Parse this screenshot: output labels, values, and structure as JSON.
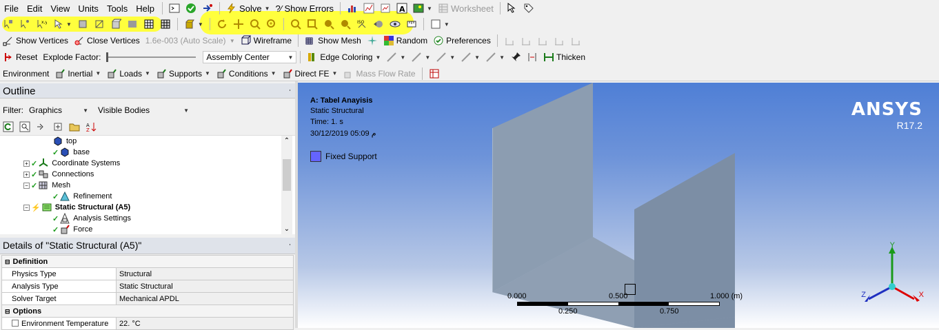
{
  "menubar": {
    "items": [
      "File",
      "Edit",
      "View",
      "Units",
      "Tools",
      "Help"
    ],
    "solve_label": "Solve",
    "show_errors_label": "?⁄ Show Errors",
    "worksheet_label": "Worksheet"
  },
  "toolbar3": {
    "show_vertices": "Show Vertices",
    "close_vertices": "Close Vertices",
    "tolerance_value": "1.6e-003 (Auto Scale)",
    "wireframe": "Wireframe",
    "show_mesh": "Show Mesh",
    "random": "Random",
    "preferences": "Preferences"
  },
  "toolbar4": {
    "reset": "Reset",
    "explode_factor": "Explode Factor:",
    "assembly_center": "Assembly Center",
    "edge_coloring": "Edge Coloring",
    "thicken": "Thicken"
  },
  "toolbar5": {
    "environment": "Environment",
    "inertial": "Inertial",
    "loads": "Loads",
    "supports": "Supports",
    "conditions": "Conditions",
    "direct_fe": "Direct FE",
    "mass_flow_rate": "Mass Flow Rate"
  },
  "outline": {
    "title": "Outline",
    "filter_label": "Filter:",
    "filter_value": "Graphics",
    "filter2_value": "Visible Bodies",
    "tree": [
      {
        "label": "top",
        "indent": 88
      },
      {
        "label": "base",
        "indent": 88
      },
      {
        "label": "Coordinate Systems",
        "indent": 36
      },
      {
        "label": "Connections",
        "indent": 36
      },
      {
        "label": "Mesh",
        "indent": 36
      },
      {
        "label": "Refinement",
        "indent": 76
      },
      {
        "label": "Static Structural (A5)",
        "indent": 36
      },
      {
        "label": "Analysis Settings",
        "indent": 76
      },
      {
        "label": "Force",
        "indent": 76
      }
    ]
  },
  "details": {
    "title": "Details of \"Static Structural (A5)\"",
    "sections": {
      "definition": "Definition",
      "options": "Options"
    },
    "rows": {
      "physics_type": {
        "label": "Physics Type",
        "value": "Structural"
      },
      "analysis_type": {
        "label": "Analysis Type",
        "value": "Static Structural"
      },
      "solver_target": {
        "label": "Solver Target",
        "value": "Mechanical APDL"
      },
      "env_temp": {
        "label": "Environment Temperature",
        "value": "22. °C"
      }
    }
  },
  "viewport": {
    "analysis_title": "A: Tabel Anayisis",
    "analysis_type": "Static Structural",
    "time": "Time: 1. s",
    "date": "30/12/2019 05:09 م",
    "legend_label": "Fixed Support",
    "legend_color": "#6464ff",
    "brand": "ANSYS",
    "version": "R17.2",
    "scale": {
      "t0": "0.000",
      "t1": "0.250",
      "t2": "0.500",
      "t3": "0.750",
      "t4": "1.000 (m)"
    },
    "axes": {
      "x": "X",
      "y": "Y",
      "z": "Z"
    }
  },
  "colors": {
    "highlight": "#ffff33",
    "viewport_top": "#4f7fd6",
    "model_face": "#8fa0b3"
  }
}
